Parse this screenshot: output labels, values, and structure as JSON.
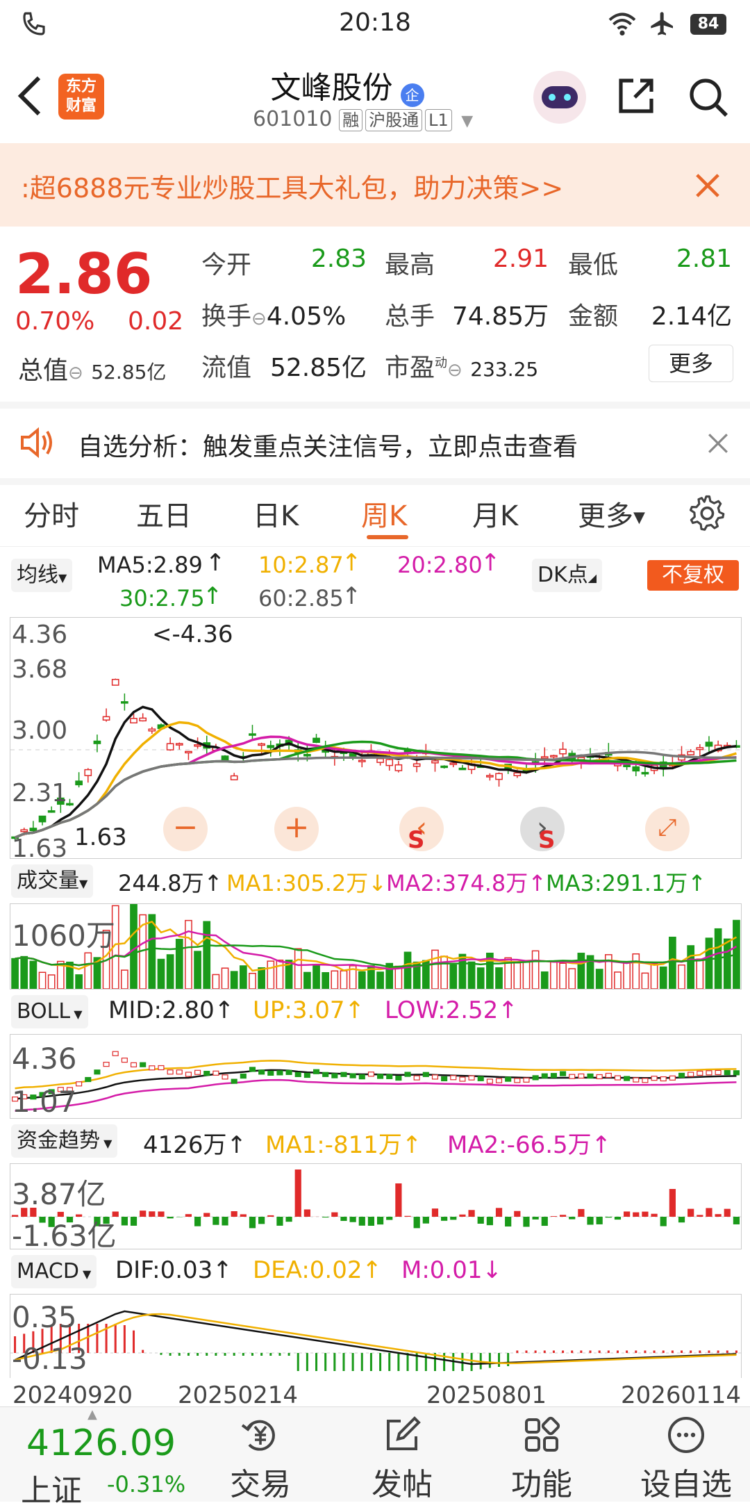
{
  "status_bar": {
    "time": "20:18",
    "battery": "84"
  },
  "header": {
    "title": "文峰股份",
    "badge": "企",
    "code": "601010",
    "tags": [
      "融",
      "沪股通",
      "L1"
    ],
    "logo_line1": "东方",
    "logo_line2": "财富"
  },
  "promo": {
    "text": ":超6888元专业炒股工具大礼包，助力决策>>"
  },
  "quote": {
    "price": "2.86",
    "change_pct": "0.70%",
    "change": "0.02",
    "total_value_label": "总值",
    "total_value": "52.85亿",
    "open_label": "今开",
    "open": "2.83",
    "high_label": "最高",
    "high": "2.91",
    "low_label": "最低",
    "low": "2.81",
    "turnover_label": "换手",
    "turnover": "4.05%",
    "volume_label": "总手",
    "volume": "74.85万",
    "amount_label": "金额",
    "amount": "2.14亿",
    "float_label": "流值",
    "float_value": "52.85亿",
    "pe_label": "市盈",
    "pe_sup": "动",
    "pe": "233.25",
    "more": "更多"
  },
  "notice": {
    "text": "自选分析：触发重点关注信号，立即点击查看"
  },
  "tabs": [
    "分时",
    "五日",
    "日K",
    "周K",
    "月K",
    "更多"
  ],
  "active_tab": "周K",
  "ma_bar": {
    "selector": "均线",
    "ma5": "MA5:2.89",
    "ma10": "10:2.87",
    "ma20": "20:2.80",
    "ma30": "30:2.75",
    "ma60": "60:2.85",
    "dk": "DK点",
    "adjust": "不复权"
  },
  "kline": {
    "y_labels": [
      "4.36",
      "3.68",
      "3.00",
      "2.31",
      "1.63"
    ],
    "max_note": "<-4.36",
    "min_note": "1.63"
  },
  "volume": {
    "selector": "成交量",
    "value": "244.8万",
    "ma1": "MA1:305.2万",
    "ma2": "MA2:374.8万",
    "ma3": "MA3:291.1万",
    "y_label": "1060万"
  },
  "boll": {
    "selector": "BOLL",
    "mid": "MID:2.80",
    "up": "UP:3.07",
    "low": "LOW:2.52",
    "y_top": "4.36",
    "y_bottom": "1.07"
  },
  "fund": {
    "selector": "资金趋势",
    "value": "4126万",
    "ma1": "MA1:-811万",
    "ma2": "MA2:-66.5万",
    "y_top": "3.87亿",
    "y_bottom": "-1.63亿"
  },
  "macd": {
    "selector": "MACD",
    "dif": "DIF:0.03",
    "dea": "DEA:0.02",
    "m": "M:0.01",
    "y_top": "0.35",
    "y_bottom": "-0.13",
    "dates": [
      "20240920",
      "20250214",
      "20250801",
      "20260114"
    ]
  },
  "bottom_nav": {
    "index_value": "4126.09",
    "index_name": "上证",
    "index_change": "-0.31%",
    "items": [
      "交易",
      "发帖",
      "功能",
      "设自选"
    ]
  },
  "colors": {
    "red": "#e02a2a",
    "green": "#1a9a1a",
    "accent": "#e8672a",
    "yellow": "#f0b000",
    "pink": "#d41ca8"
  }
}
